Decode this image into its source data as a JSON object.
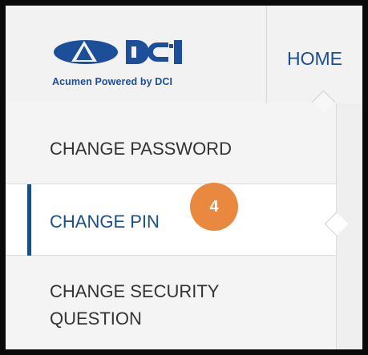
{
  "brand": {
    "logo_mark": "DCI",
    "tagline": "Acumen Powered by DCI",
    "logo_color": "#1d4e9a"
  },
  "nav": {
    "home_label": "HOME"
  },
  "menu": {
    "items": [
      {
        "label": "CHANGE PASSWORD",
        "active": false
      },
      {
        "label": "CHANGE PIN",
        "active": true
      },
      {
        "label_line1": "CHANGE SECURITY",
        "label_line2": "QUESTION",
        "active": false
      }
    ]
  },
  "annotation": {
    "step_number": "4",
    "badge_color": "#e9893f"
  },
  "colors": {
    "accent": "#1a4f8a",
    "text": "#333333",
    "border": "#0a0a0a"
  }
}
